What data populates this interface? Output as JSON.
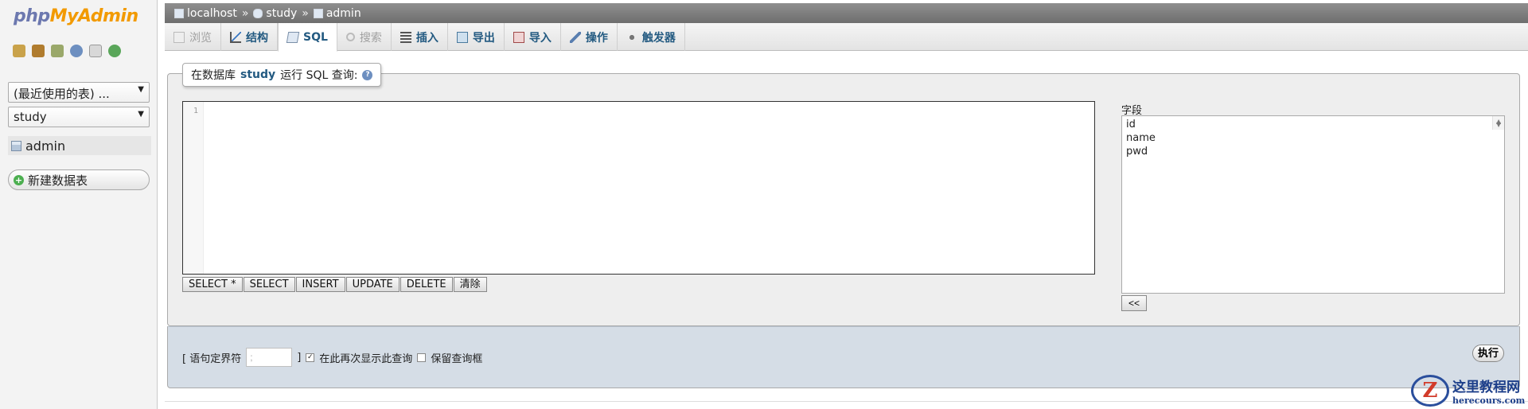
{
  "nav": {
    "logo_php": "php",
    "logo_myadmin": "MyAdmin",
    "icons": [
      "home-icon",
      "logout-icon",
      "query-window-icon",
      "docs-icon",
      "help-icon",
      "reload-icon"
    ],
    "recent_tables": "(最近使用的表) ...",
    "database": "study",
    "table": "admin",
    "new_table": "新建数据表"
  },
  "breadcrumb": {
    "server": "localhost",
    "database": "study",
    "table": "admin",
    "separator": "»"
  },
  "tabs": [
    {
      "label": "浏览",
      "icon": "browse-icon",
      "state": "disabled"
    },
    {
      "label": "结构",
      "icon": "structure-icon",
      "state": "normal"
    },
    {
      "label": "SQL",
      "icon": "sql-icon",
      "state": "active"
    },
    {
      "label": "搜索",
      "icon": "search-icon",
      "state": "disabled"
    },
    {
      "label": "插入",
      "icon": "insert-icon",
      "state": "normal"
    },
    {
      "label": "导出",
      "icon": "export-icon",
      "state": "normal"
    },
    {
      "label": "导入",
      "icon": "import-icon",
      "state": "normal"
    },
    {
      "label": "操作",
      "icon": "operations-icon",
      "state": "normal"
    },
    {
      "label": "触发器",
      "icon": "triggers-icon",
      "state": "normal"
    }
  ],
  "sql": {
    "legend_prefix": "在数据库",
    "legend_db": "study",
    "legend_suffix": "运行 SQL 查询:",
    "line_number": "1",
    "query": "",
    "buttons": [
      "SELECT *",
      "SELECT",
      "INSERT",
      "UPDATE",
      "DELETE",
      "清除"
    ]
  },
  "fields": {
    "label": "字段",
    "items": [
      "id",
      "name",
      "pwd"
    ],
    "insert_button": "<<"
  },
  "options": {
    "delimiter_label_open": "[ 语句定界符",
    "delimiter_value": ";",
    "delimiter_label_close": "]",
    "show_again_label": "在此再次显示此查询",
    "show_again_checked": true,
    "retain_box_label": "保留查询框",
    "retain_box_checked": false,
    "go_button": "执行"
  },
  "watermark": {
    "logo": "Z",
    "title": "这里教程网",
    "url": "herecours.com"
  }
}
